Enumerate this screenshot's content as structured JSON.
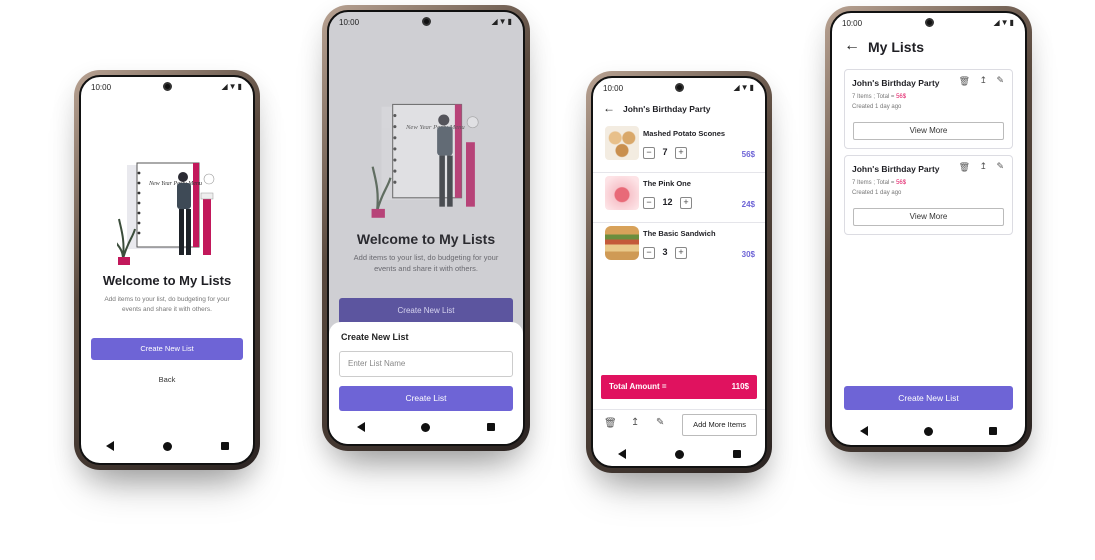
{
  "status": {
    "time": "10:00",
    "sys": "◢▼▮"
  },
  "screen1": {
    "title": "Welcome to My Lists",
    "subtitle": "Add items to your list, do budgeting for your events and share it with others.",
    "create_button": "Create New List",
    "back_button": "Back",
    "notebook_text": "New Year Party Menu"
  },
  "screen2": {
    "title": "Welcome to My Lists",
    "subtitle": "Add items to your list, do budgeting for your events and share it with others.",
    "create_button": "Create New List",
    "sheet_title": "Create New List",
    "input_placeholder": "Enter List Name",
    "create_list_button": "Create List",
    "notebook_text": "New Year Party Menu"
  },
  "screen3": {
    "header_title": "John's Birthday Party",
    "items": [
      {
        "name": "Mashed Potato Scones",
        "qty": "7",
        "price": "56$"
      },
      {
        "name": "The Pink One",
        "qty": "12",
        "price": "24$"
      },
      {
        "name": "The Basic Sandwich",
        "qty": "3",
        "price": "30$"
      }
    ],
    "total_label": "Total Amount =",
    "total_value": "110$",
    "add_more_button": "Add More Items"
  },
  "screen4": {
    "header_title": "My Lists",
    "lists": [
      {
        "name": "John's Birthday Party",
        "meta_prefix": "7 Items ; Total = ",
        "meta_total": "56$",
        "created": "Created 1 day ago",
        "view_more": "View More"
      },
      {
        "name": "John's Birthday Party",
        "meta_prefix": "7 Items ; Total = ",
        "meta_total": "56$",
        "created": "Created 1 day ago",
        "view_more": "View More"
      }
    ],
    "create_button": "Create New List"
  },
  "colors": {
    "accent": "#6e64d6",
    "pink": "#e0125f",
    "price": "#6e64d6"
  }
}
